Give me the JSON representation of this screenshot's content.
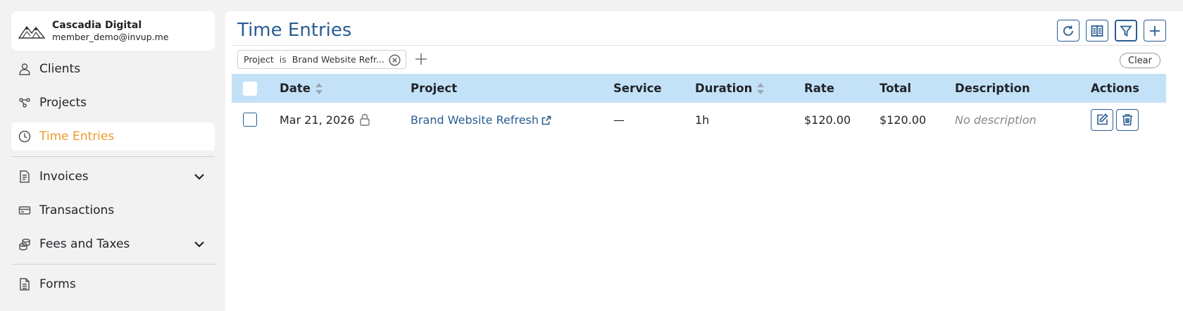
{
  "org": {
    "name": "Cascadia Digital",
    "email": "member_demo@invup.me"
  },
  "sidebar": {
    "items": [
      {
        "label": "Clients",
        "icon": "user-icon"
      },
      {
        "label": "Projects",
        "icon": "projects-icon"
      },
      {
        "label": "Time Entries",
        "icon": "clock-icon",
        "active": true
      },
      {
        "label": "Invoices",
        "icon": "invoice-icon",
        "expandable": true
      },
      {
        "label": "Transactions",
        "icon": "card-icon"
      },
      {
        "label": "Fees and Taxes",
        "icon": "coins-icon",
        "expandable": true
      },
      {
        "label": "Forms",
        "icon": "form-icon"
      }
    ]
  },
  "page": {
    "title": "Time Entries"
  },
  "toolbar": {
    "buttons": [
      {
        "icon": "refresh-icon"
      },
      {
        "icon": "columns-icon"
      },
      {
        "icon": "filter-icon",
        "active": true
      },
      {
        "icon": "plus-icon"
      }
    ]
  },
  "filter": {
    "field": "Project",
    "operator": "is",
    "value": "Brand Website Refr...",
    "clear_label": "Clear"
  },
  "table": {
    "columns": [
      "Date",
      "Project",
      "Service",
      "Duration",
      "Rate",
      "Total",
      "Description",
      "Actions"
    ],
    "rows": [
      {
        "date": "Mar 21, 2026",
        "project": "Brand Website Refresh",
        "service": "—",
        "duration": "1h",
        "rate": "$120.00",
        "total": "$120.00",
        "description": "No description"
      }
    ]
  },
  "colors": {
    "accent": "#2a5d93",
    "active_nav": "#f09a2f",
    "header_bg": "#c4e2f7"
  }
}
